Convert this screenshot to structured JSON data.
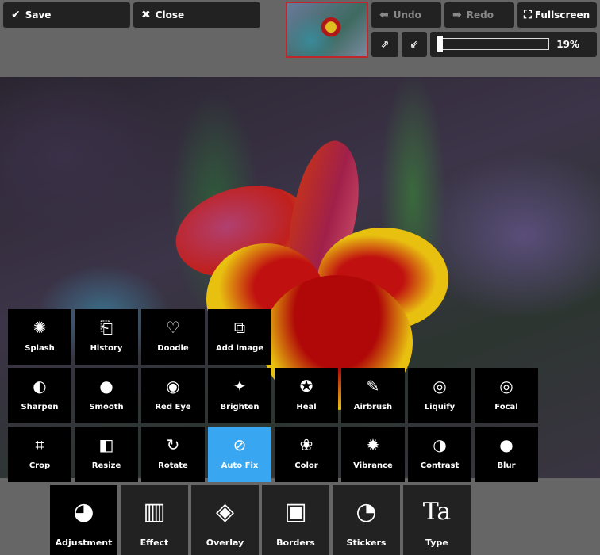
{
  "toolbar": {
    "save": "Save",
    "close": "Close",
    "undo": "Undo",
    "redo": "Redo",
    "fullscreen": "Fullscreen",
    "zoom_percent": "19%",
    "zoom_level": 19
  },
  "colors": {
    "active_tile": "#39a6f2",
    "button_bg": "#222222",
    "thumb_border": "#c0262b"
  },
  "tools": [
    {
      "label": "Splash",
      "icon": "splash-icon"
    },
    {
      "label": "History",
      "icon": "history-icon"
    },
    {
      "label": "Doodle",
      "icon": "doodle-icon"
    },
    {
      "label": "Add image",
      "icon": "add-image-icon"
    },
    {
      "label": "Sharpen",
      "icon": "sharpen-icon"
    },
    {
      "label": "Smooth",
      "icon": "smooth-icon"
    },
    {
      "label": "Red Eye",
      "icon": "eye-icon"
    },
    {
      "label": "Brighten",
      "icon": "sparkle-icon"
    },
    {
      "label": "Heal",
      "icon": "heal-icon"
    },
    {
      "label": "Airbrush",
      "icon": "airbrush-icon"
    },
    {
      "label": "Liquify",
      "icon": "liquify-icon"
    },
    {
      "label": "Focal",
      "icon": "focal-icon"
    },
    {
      "label": "Crop",
      "icon": "crop-icon"
    },
    {
      "label": "Resize",
      "icon": "resize-icon"
    },
    {
      "label": "Rotate",
      "icon": "rotate-icon"
    },
    {
      "label": "Auto Fix",
      "icon": "auto-fix-icon",
      "active": true
    },
    {
      "label": "Color",
      "icon": "color-icon"
    },
    {
      "label": "Vibrance",
      "icon": "vibrance-icon"
    },
    {
      "label": "Contrast",
      "icon": "contrast-icon"
    },
    {
      "label": "Blur",
      "icon": "blur-icon"
    }
  ],
  "tabs": [
    {
      "label": "Adjustment",
      "icon": "adjustment-icon",
      "active": true
    },
    {
      "label": "Effect",
      "icon": "film-icon"
    },
    {
      "label": "Overlay",
      "icon": "layers-icon"
    },
    {
      "label": "Borders",
      "icon": "border-icon"
    },
    {
      "label": "Stickers",
      "icon": "sticker-icon"
    },
    {
      "label": "Type",
      "icon": "type-icon"
    }
  ]
}
